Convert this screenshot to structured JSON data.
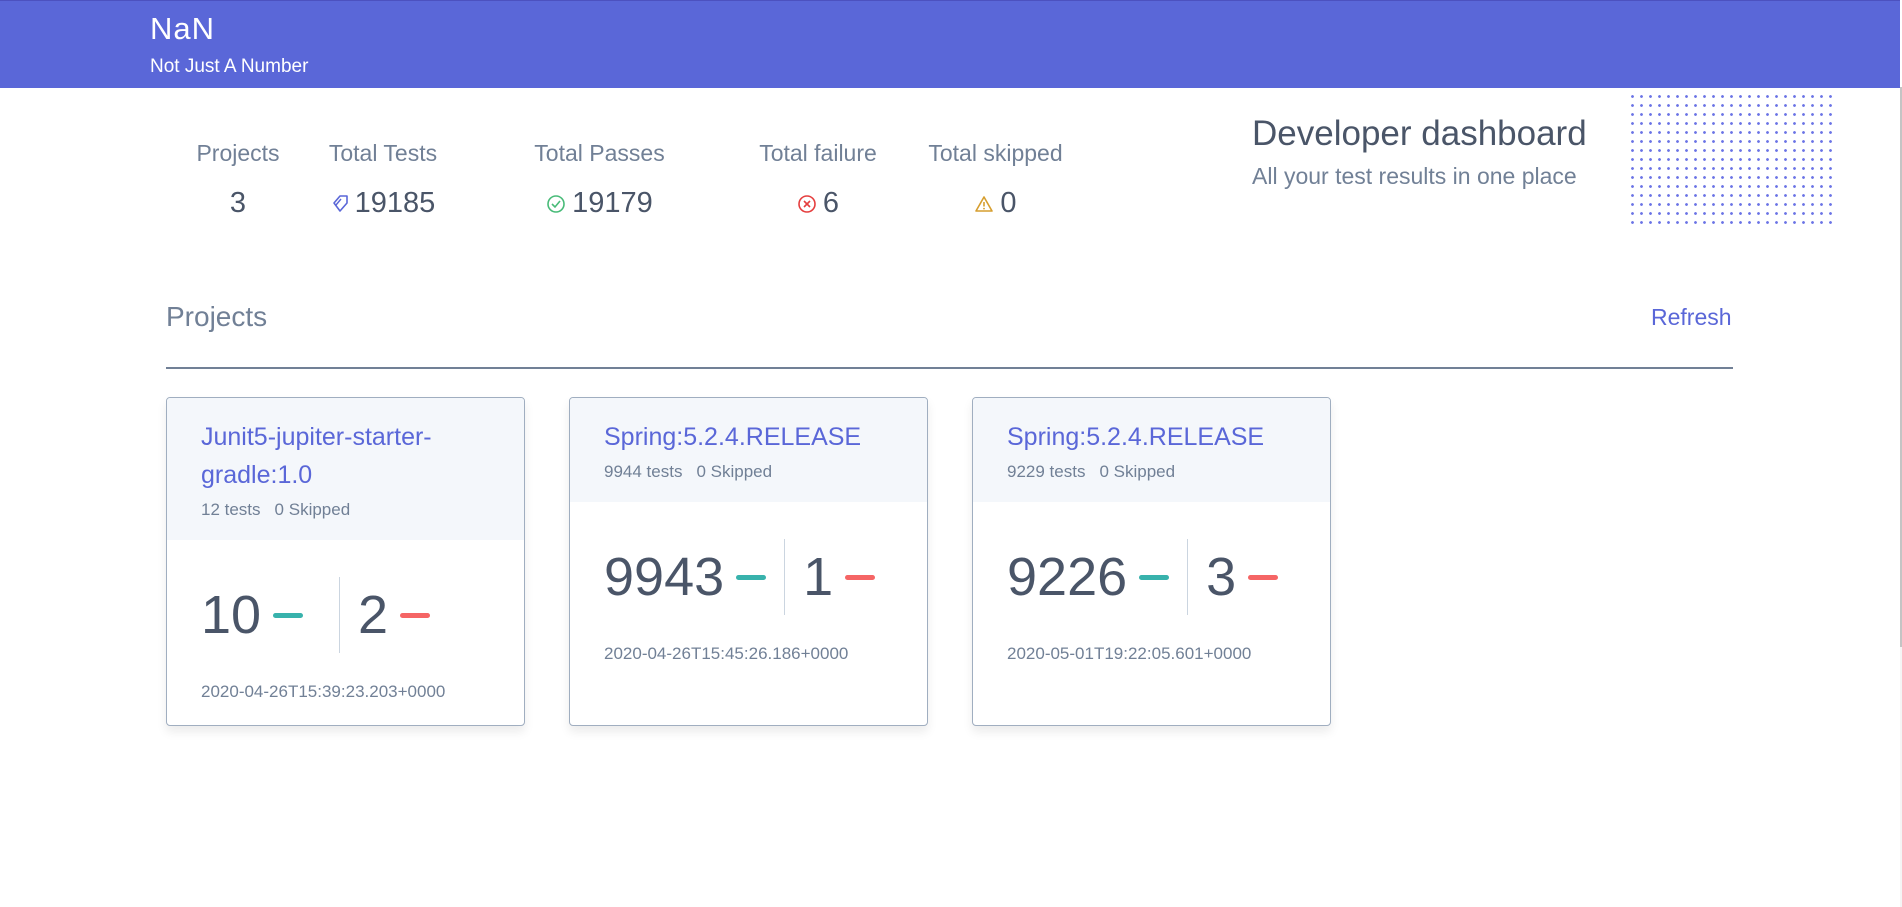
{
  "header": {
    "title": "NaN",
    "subtitle": "Not Just A Number"
  },
  "stats": {
    "projects": {
      "label": "Projects",
      "value": "3"
    },
    "total_tests": {
      "label": "Total Tests",
      "value": "19185",
      "icon": "tag-icon"
    },
    "total_passes": {
      "label": "Total Passes",
      "value": "19179",
      "icon": "check-circle-icon"
    },
    "total_failure": {
      "label": "Total failure",
      "value": "6",
      "icon": "x-circle-icon"
    },
    "total_skipped": {
      "label": "Total skipped",
      "value": "0",
      "icon": "warning-icon"
    }
  },
  "dashboard": {
    "title": "Developer dashboard",
    "subtitle": "All your test results in one place"
  },
  "projects_section": {
    "title": "Projects",
    "refresh_label": "Refresh"
  },
  "projects": [
    {
      "name": "Junit5-jupiter-starter-gradle:1.0",
      "tests": "12 tests",
      "skipped": "0 Skipped",
      "passed": "10",
      "failed": "2",
      "timestamp": "2020-04-26T15:39:23.203+0000"
    },
    {
      "name": "Spring:5.2.4.RELEASE",
      "tests": "9944 tests",
      "skipped": "0 Skipped",
      "passed": "9943",
      "failed": "1",
      "timestamp": "2020-04-26T15:45:26.186+0000"
    },
    {
      "name": "Spring:5.2.4.RELEASE",
      "tests": "9229 tests",
      "skipped": "0 Skipped",
      "passed": "9226",
      "failed": "3",
      "timestamp": "2020-05-01T19:22:05.601+0000"
    }
  ],
  "colors": {
    "accent": "#5a67d8",
    "pass": "#38b2ac",
    "fail": "#f56565",
    "passes_icon": "#48bb78",
    "failure_icon": "#e53e3e",
    "skipped_icon": "#d69e2e"
  }
}
